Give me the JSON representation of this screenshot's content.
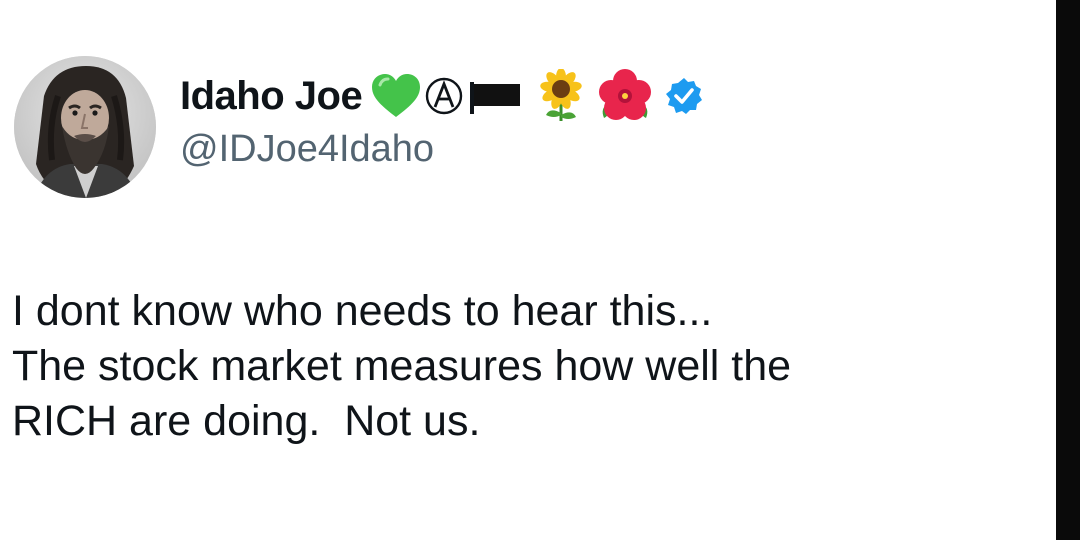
{
  "tweet": {
    "author": {
      "display_name": "Idaho Joe",
      "handle": "@IDJoe4Idaho",
      "verified": true,
      "name_badges": [
        "green-heart-icon",
        "circled-a-icon",
        "black-flag-icon",
        "sunflower-icon",
        "hibiscus-icon"
      ],
      "verified_color": "#1d9bf0"
    },
    "text_lines": [
      "I dont know who needs to hear this...",
      "The stock market measures how well the",
      "RICH are doing.  Not us."
    ]
  },
  "colors": {
    "text": "#0f1419",
    "handle": "#536471",
    "heart": "#44c34a",
    "right_bar": "#0a0a0a"
  }
}
